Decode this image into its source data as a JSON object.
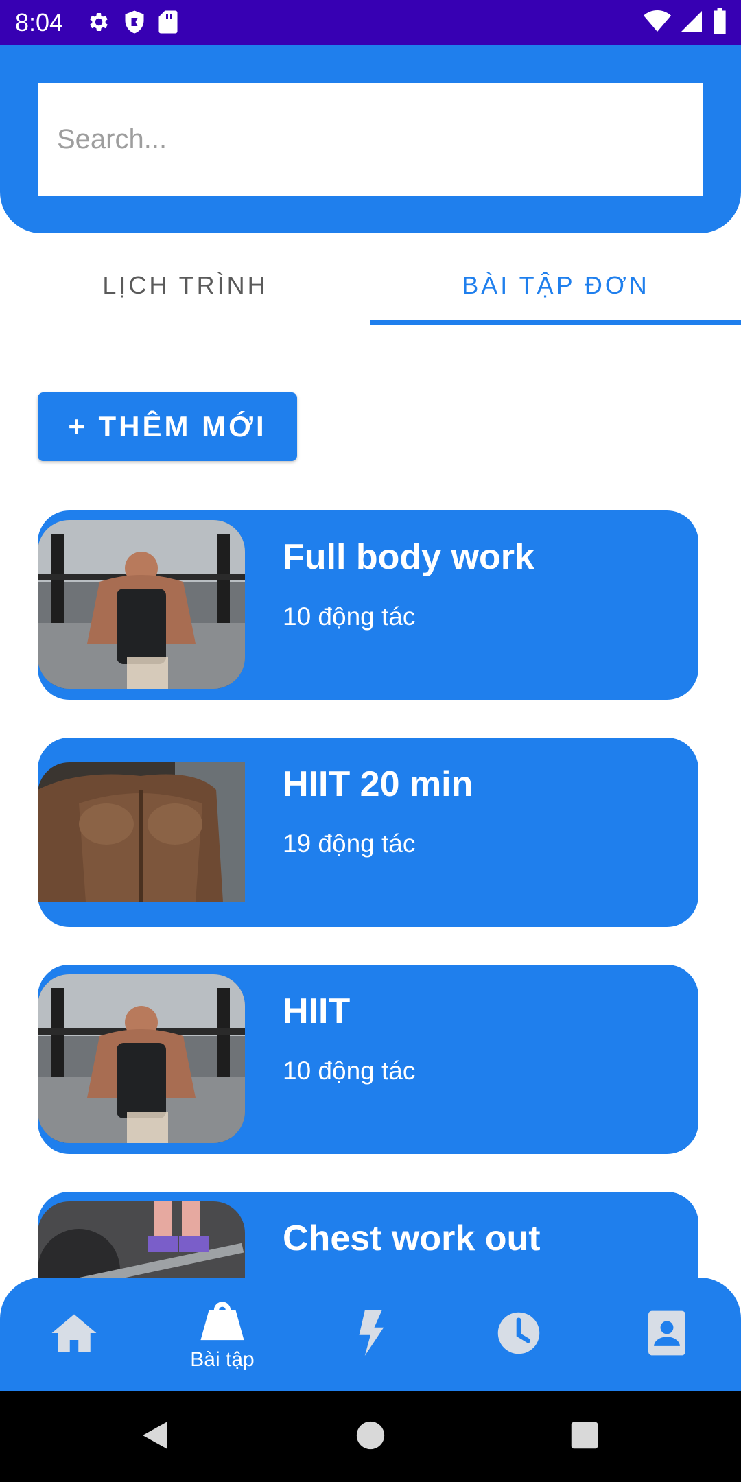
{
  "status_bar": {
    "time": "8:04",
    "left_icons": [
      "gear-icon",
      "shield-icon",
      "sd-card-icon"
    ],
    "right_icons": [
      "wifi-icon",
      "signal-icon",
      "battery-icon"
    ]
  },
  "search": {
    "placeholder": "Search...",
    "value": ""
  },
  "tabs": [
    {
      "label": "LỊCH TRÌNH",
      "selected": false
    },
    {
      "label": "BÀI TẬP ĐƠN",
      "selected": true
    }
  ],
  "add_button": {
    "label": "+ THÊM MỚI"
  },
  "workouts": [
    {
      "title": "Full body work",
      "subtitle": "10 động tác",
      "image": "barbell-press-photo"
    },
    {
      "title": "HIIT 20 min",
      "subtitle": "19 động tác",
      "image": "muscular-back-photo"
    },
    {
      "title": "HIIT",
      "subtitle": "10 động tác",
      "image": "barbell-press-photo"
    },
    {
      "title": "Chest work out",
      "subtitle": "",
      "image": "deadlift-floor-photo"
    }
  ],
  "bottom_nav": [
    {
      "icon": "home-icon",
      "label": "",
      "selected": false
    },
    {
      "icon": "kettlebell-icon",
      "label": "Bài tập",
      "selected": true
    },
    {
      "icon": "lightning-icon",
      "label": "",
      "selected": false
    },
    {
      "icon": "clock-icon",
      "label": "",
      "selected": false
    },
    {
      "icon": "contact-card-icon",
      "label": "",
      "selected": false
    }
  ],
  "colors": {
    "primary": "#1f7fed",
    "status_bar": "#3700b3",
    "nav_icon_inactive": "#d7dde6",
    "nav_icon_active": "#ffffff"
  }
}
